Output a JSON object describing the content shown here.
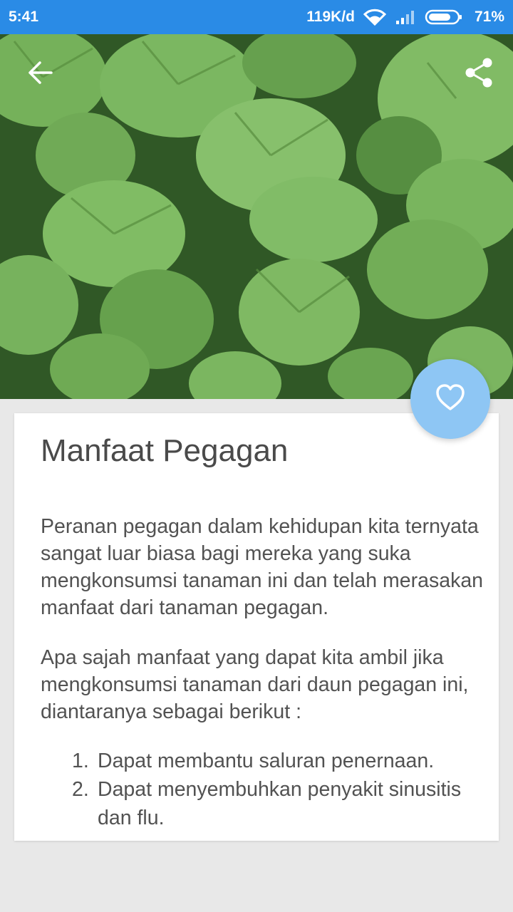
{
  "status_bar": {
    "time": "5:41",
    "network_speed": "119K/d",
    "battery_percent": "71%"
  },
  "hero": {
    "image_alt": "pegagan leaves",
    "back_icon": "arrow-left-icon",
    "share_icon": "share-icon"
  },
  "article": {
    "title": "Manfaat Pegagan",
    "paragraphs": [
      "Peranan pegagan dalam kehidupan kita ternyata sangat luar biasa bagi mereka yang suka mengkonsumsi tanaman ini dan telah merasakan manfaat dari tanaman pegagan.",
      "Apa sajah manfaat yang dapat kita ambil jika mengkonsumsi tanaman dari daun pegagan ini, diantaranya sebagai berikut :"
    ],
    "list": [
      {
        "num": "1.",
        "text": "Dapat membantu saluran penernaan."
      },
      {
        "num": "2.",
        "text": "Dapat menyembuhkan penyakit sinusitis dan flu."
      }
    ]
  },
  "fab": {
    "icon": "heart-outline-icon",
    "color": "#8ec6f4"
  },
  "colors": {
    "status_bar": "#2a8be6",
    "background": "#e8e8e8",
    "card": "#ffffff"
  }
}
